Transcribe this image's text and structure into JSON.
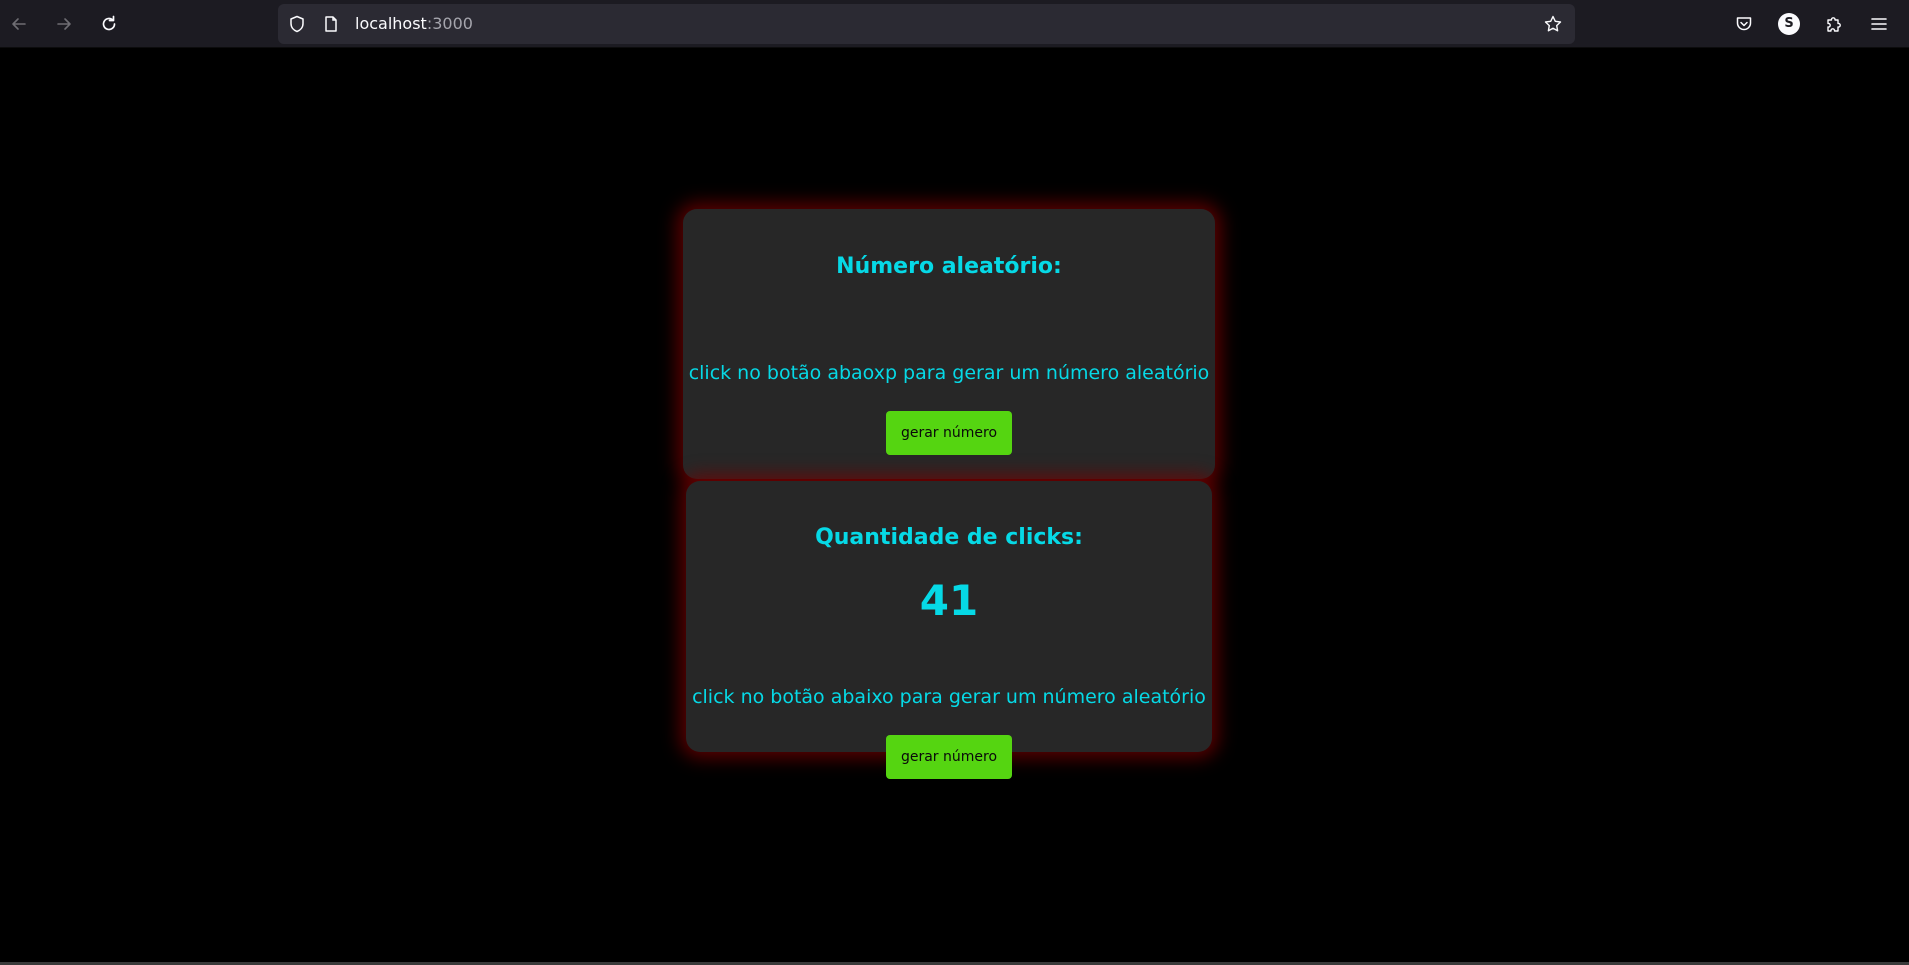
{
  "browser": {
    "url_host": "localhost",
    "url_port": ":3000",
    "avatar_letter": "S",
    "icons": {
      "back": "arrow-left-icon",
      "forward": "arrow-right-icon",
      "reload": "reload-icon",
      "shield": "shield-icon",
      "page": "page-icon",
      "bookmark": "star-icon",
      "pocket": "pocket-icon",
      "account": "account-icon",
      "extensions": "puzzle-icon",
      "menu": "hamburger-menu-icon"
    }
  },
  "cards": {
    "random": {
      "title": "Número aleatório:",
      "value": "",
      "hint": "click no botão abaoxp para gerar um número aleatório",
      "button_label": "gerar número"
    },
    "clicks": {
      "title": "Quantidade de clicks:",
      "value": "41",
      "hint": "click no botão abaixo para gerar um número aleatório",
      "button_label": "gerar número"
    }
  },
  "colors": {
    "accent_text": "#06d9e6",
    "button_green": "#55d511",
    "card_bg": "#272727",
    "glow_red": "#780000",
    "page_bg": "#000000",
    "toolbar_bg": "#1c1b22"
  }
}
